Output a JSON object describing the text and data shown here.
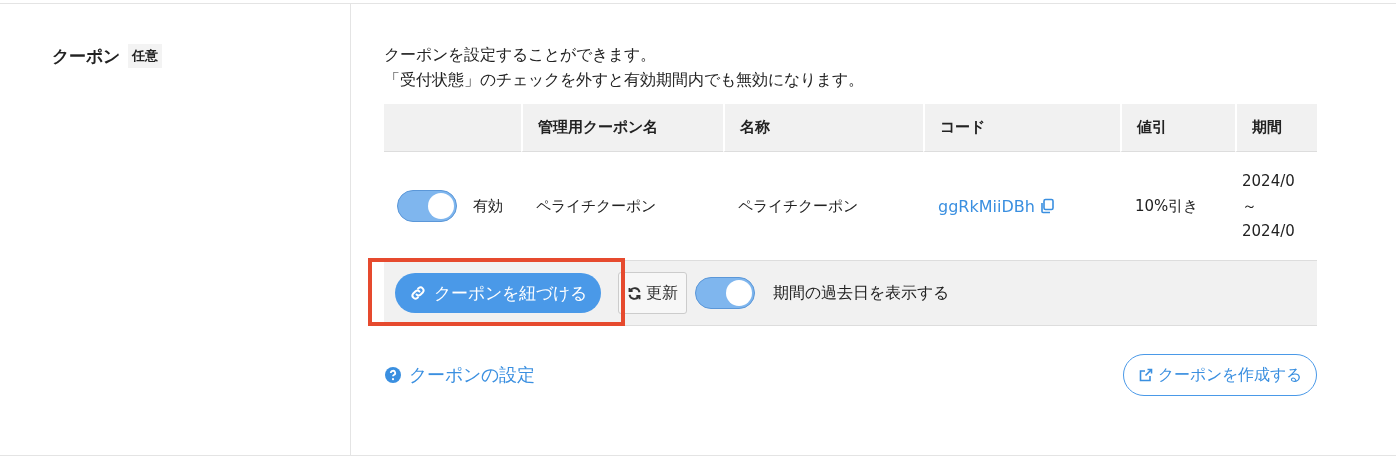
{
  "section": {
    "label": "クーポン",
    "badge": "任意"
  },
  "description": [
    "クーポンを設定することができます。",
    "「受付状態」のチェックを外すと有効期間内でも無効になります。"
  ],
  "table": {
    "columns": [
      "",
      "管理用クーポン名",
      "名称",
      "コード",
      "値引",
      "期間"
    ],
    "rows": [
      {
        "enabled": true,
        "status": "有効",
        "admin_name": "ペライチクーポン",
        "name": "ペライチクーポン",
        "code": "ggRkMiiDBh",
        "discount": "10%引き",
        "period": [
          "2024/0",
          "～",
          "2024/0"
        ]
      }
    ]
  },
  "toolbar": {
    "link_button": "クーポンを紐づける",
    "highlighted": true,
    "refresh_button": "更新",
    "show_past": {
      "on": true,
      "label": "期間の過去日を表示する"
    }
  },
  "help_link": "クーポンの設定",
  "create_button": "クーポンを作成する"
}
